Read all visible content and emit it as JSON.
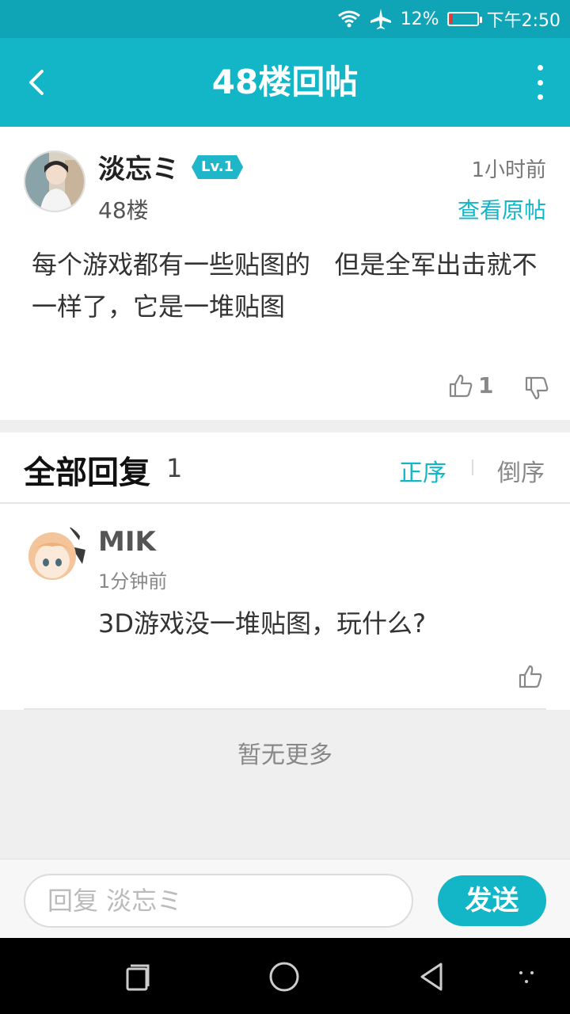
{
  "status_bar": {
    "battery": "12%",
    "time": "下午2:50",
    "battery_level": 0.12,
    "battery_color": "#e53935"
  },
  "app_bar": {
    "title": "48楼回帖",
    "accent": "#13b6c7"
  },
  "post": {
    "author": "淡忘ミ",
    "level": "Lv.1",
    "floor": "48楼",
    "time": "1小时前",
    "view_original": "查看原帖",
    "content": "每个游戏都有一些贴图的   但是全军出击就不一样了，它是一堆贴图",
    "like_count": "1"
  },
  "replies_header": {
    "title": "全部回复",
    "count": "1",
    "sort_asc": "正序",
    "sort_desc": "倒序"
  },
  "replies": [
    {
      "user": "MIK",
      "time": "1分钟前",
      "text": "3D游戏没一堆贴图，玩什么?"
    }
  ],
  "no_more": "暂无更多",
  "input": {
    "placeholder": "回复 淡忘ミ",
    "send_label": "发送"
  }
}
